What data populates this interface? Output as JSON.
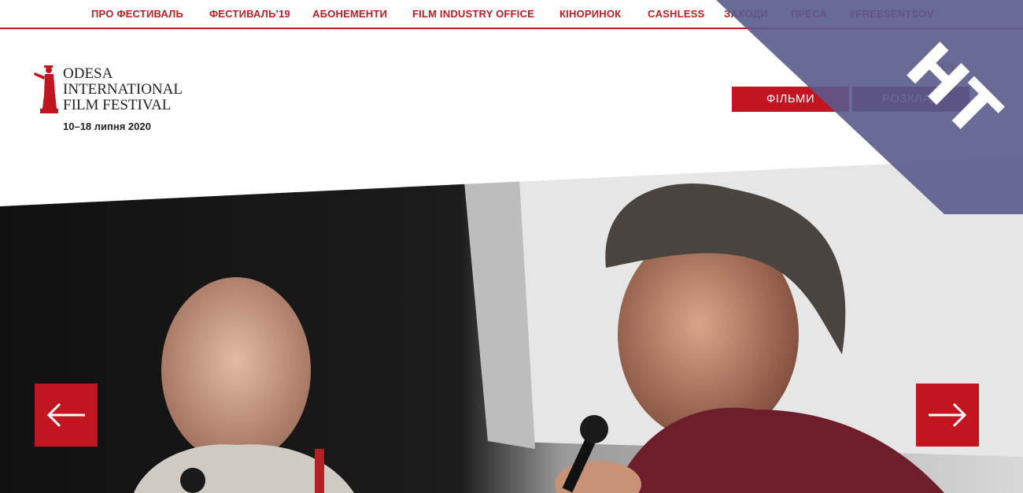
{
  "nav": {
    "items": [
      {
        "label": "ПРО ФЕСТИВАЛЬ"
      },
      {
        "label": "ФЕСТИВАЛЬ'19"
      },
      {
        "label": "АБОНЕМЕНТИ"
      },
      {
        "label": "FILM INDUSTRY OFFICE"
      },
      {
        "label": "КІНОРИНОК"
      },
      {
        "label": "CASHLESS"
      },
      {
        "label": "ЗАХОДИ"
      },
      {
        "label": "ПРЕСА"
      },
      {
        "label": "#FREESENTSOV"
      }
    ]
  },
  "logo": {
    "line1": "ODESA",
    "line2": "INTERNATIONAL",
    "line3": "FILM FESTIVAL",
    "dates": "10–18 липня 2020"
  },
  "buttons": {
    "films": "ФІЛЬМИ",
    "schedule": "РОЗКЛАД"
  },
  "language": {
    "current": "EN"
  },
  "hero": {
    "prev_icon": "arrow-left-icon",
    "next_icon": "arrow-right-icon"
  },
  "badge": {
    "text": "HT",
    "color": "#5a5a8c"
  },
  "colors": {
    "accent": "#c2151f",
    "nav_text": "#b52026",
    "schedule_button": "#7a1e52"
  }
}
